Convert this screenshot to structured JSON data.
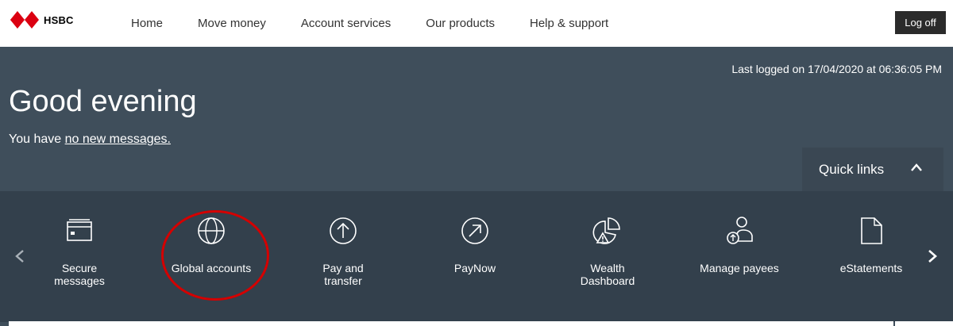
{
  "brand": {
    "name": "HSBC",
    "accent": "#db0011"
  },
  "nav": {
    "items": [
      {
        "label": "Home"
      },
      {
        "label": "Move money"
      },
      {
        "label": "Account services"
      },
      {
        "label": "Our products"
      },
      {
        "label": "Help & support"
      }
    ],
    "logout_label": "Log off"
  },
  "hero": {
    "last_logged": "Last logged on 17/04/2020 at 06:36:05 PM",
    "greeting": "Good evening",
    "messages_prefix": "You have ",
    "messages_link": "no new messages."
  },
  "quick_links": {
    "tab_label": "Quick links",
    "items": [
      {
        "label": "Secure messages",
        "icon": "secure-messages-icon"
      },
      {
        "label": "Global accounts",
        "icon": "globe-icon"
      },
      {
        "label": "Pay and transfer",
        "icon": "pay-transfer-icon"
      },
      {
        "label": "PayNow",
        "icon": "paynow-icon"
      },
      {
        "label": "Wealth Dashboard",
        "icon": "wealth-dashboard-icon"
      },
      {
        "label": "Manage payees",
        "icon": "manage-payees-icon"
      },
      {
        "label": "eStatements",
        "icon": "estatements-icon"
      }
    ],
    "highlight_color": "#d40000"
  }
}
